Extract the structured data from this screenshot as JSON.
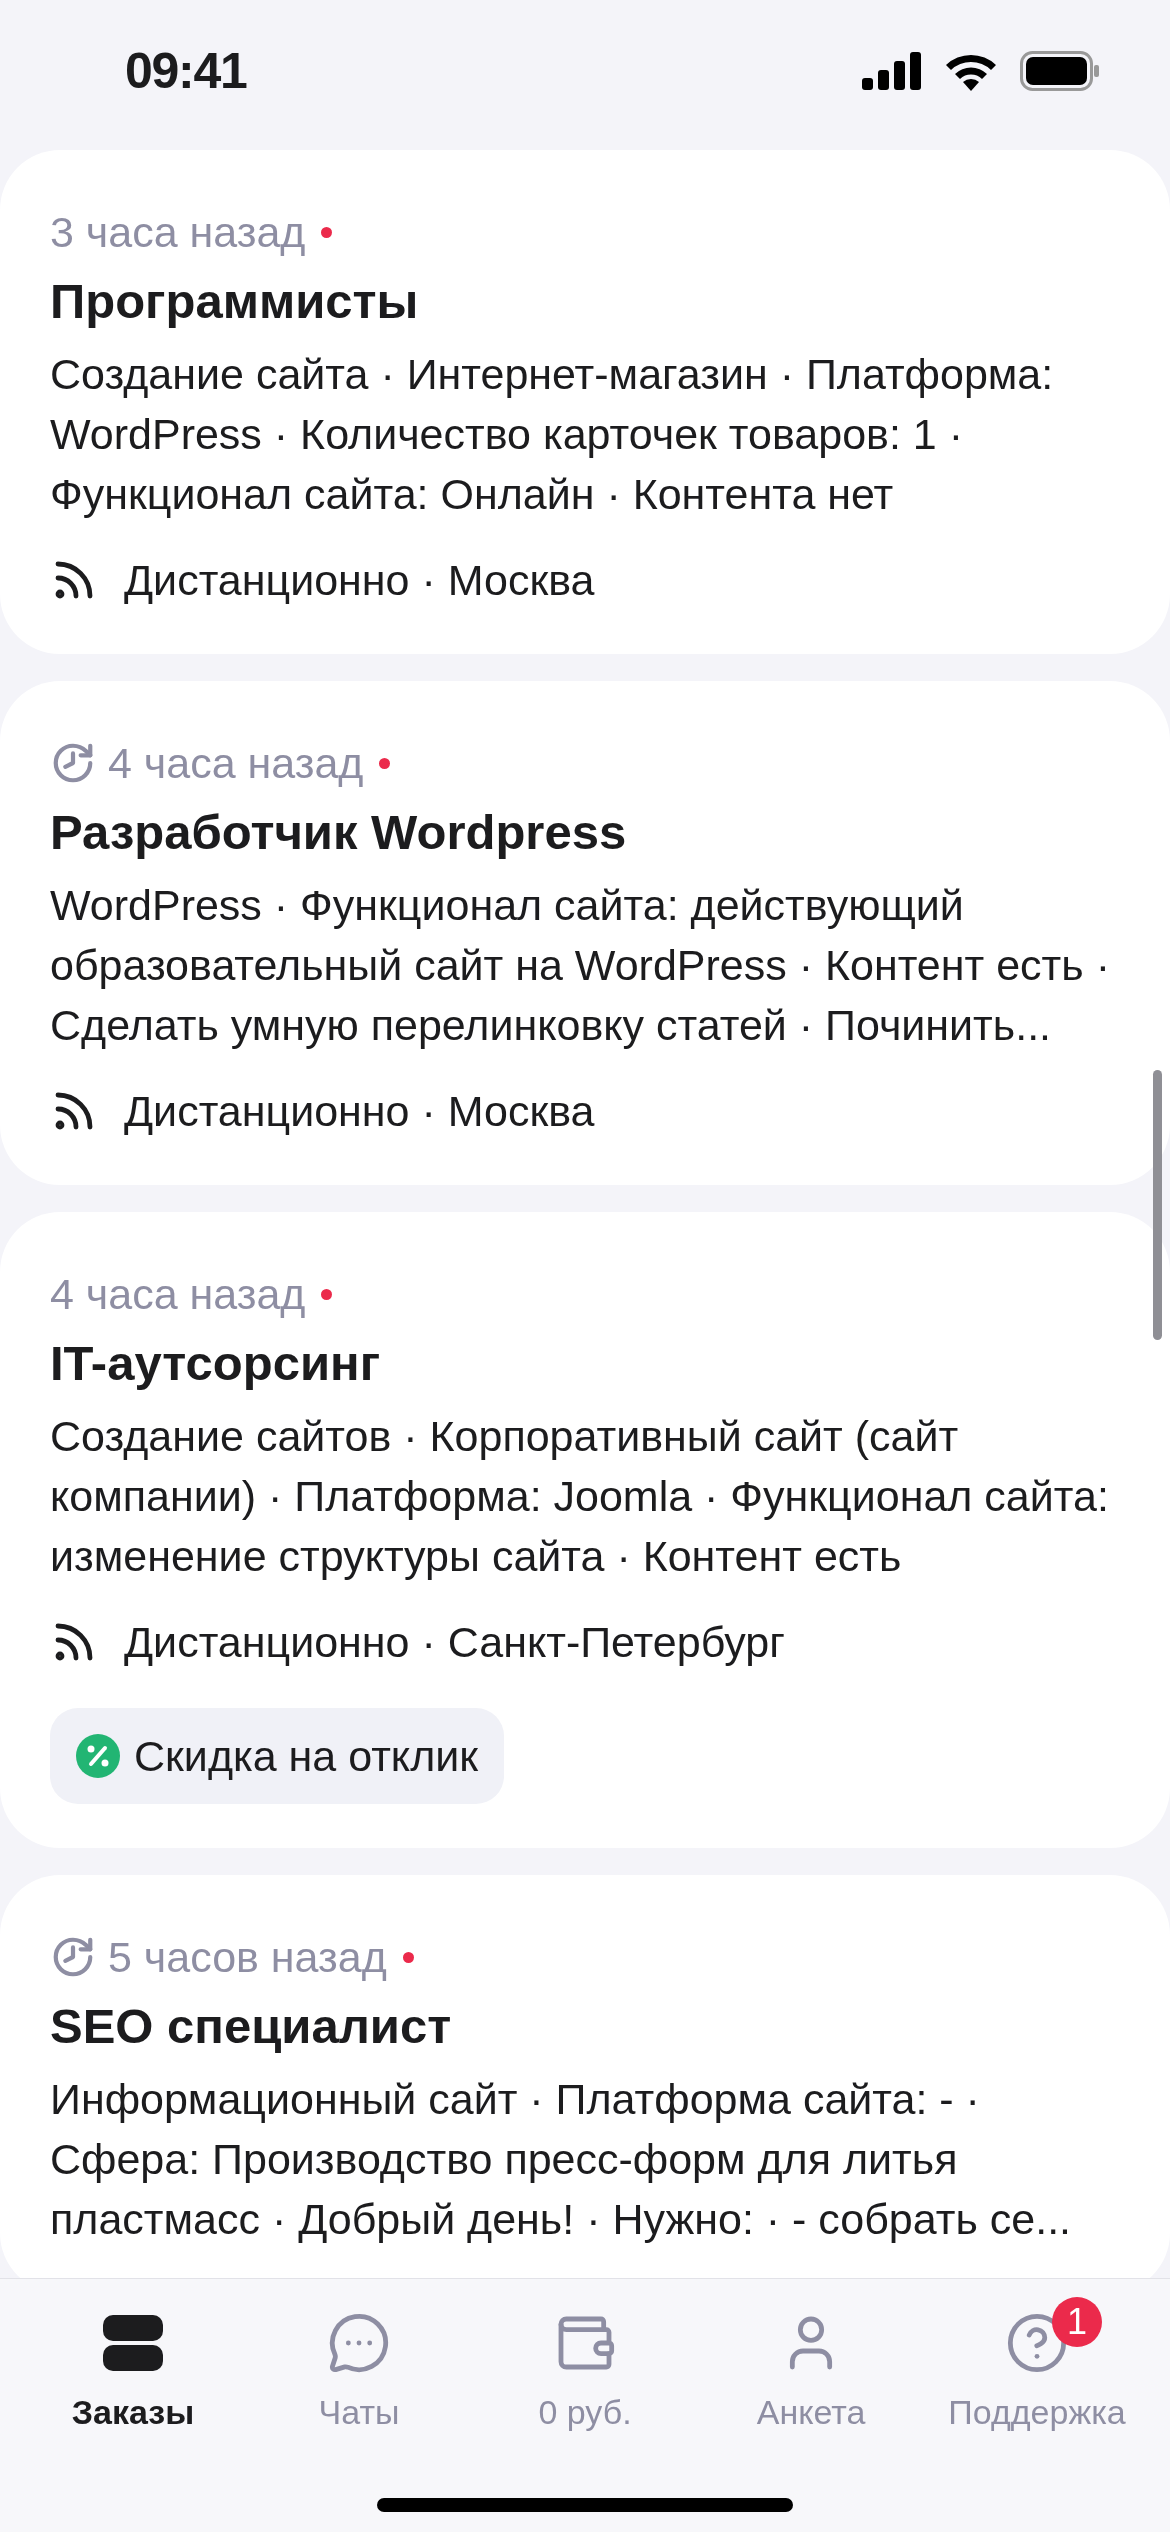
{
  "status_bar": {
    "time": "09:41"
  },
  "orders": [
    {
      "time": "3 часа назад",
      "clock": false,
      "unread": true,
      "title": "Программисты",
      "description": "Создание сайта · Интернет-магазин · Платформа: WordPress · Количество карточек товаров: 1 · Функционал сайта: Онлайн · Контента нет",
      "location": "Дистанционно · Москва"
    },
    {
      "time": "4 часа назад",
      "clock": true,
      "unread": true,
      "title": "Разработчик Wordpress",
      "description": "WordPress · Функционал сайта: действующий образовательный сайт на WordPress · Контент есть · Сделать умную перелинковку статей · Починить...",
      "location": "Дистанционно · Москва"
    },
    {
      "time": "4 часа назад",
      "clock": false,
      "unread": true,
      "title": "IT-аутсорсинг",
      "description": "Создание сайтов · Корпоративный сайт (сайт компании) · Платформа: Joomla · Функционал сайта: изменение структуры сайта · Контент есть",
      "location": "Дистанционно · Санкт-Петербург",
      "badge": "Скидка на отклик"
    },
    {
      "time": "5 часов назад",
      "clock": true,
      "unread": true,
      "title": "SEO специалист",
      "description": "Информационный сайт · Платформа сайта: - · Сфера: Производство пресс-форм для литья пластмасс · Добрый день! · Нужно: · - собрать се..."
    }
  ],
  "tab_bar": [
    {
      "kind": "orders",
      "label": "Заказы",
      "selected": true
    },
    {
      "kind": "chats",
      "label": "Чаты",
      "selected": false
    },
    {
      "kind": "wallet",
      "label": "0 руб.",
      "selected": false
    },
    {
      "kind": "profile",
      "label": "Анкета",
      "selected": false
    },
    {
      "kind": "support",
      "label": "Поддержка",
      "selected": false,
      "badge": "1"
    }
  ]
}
